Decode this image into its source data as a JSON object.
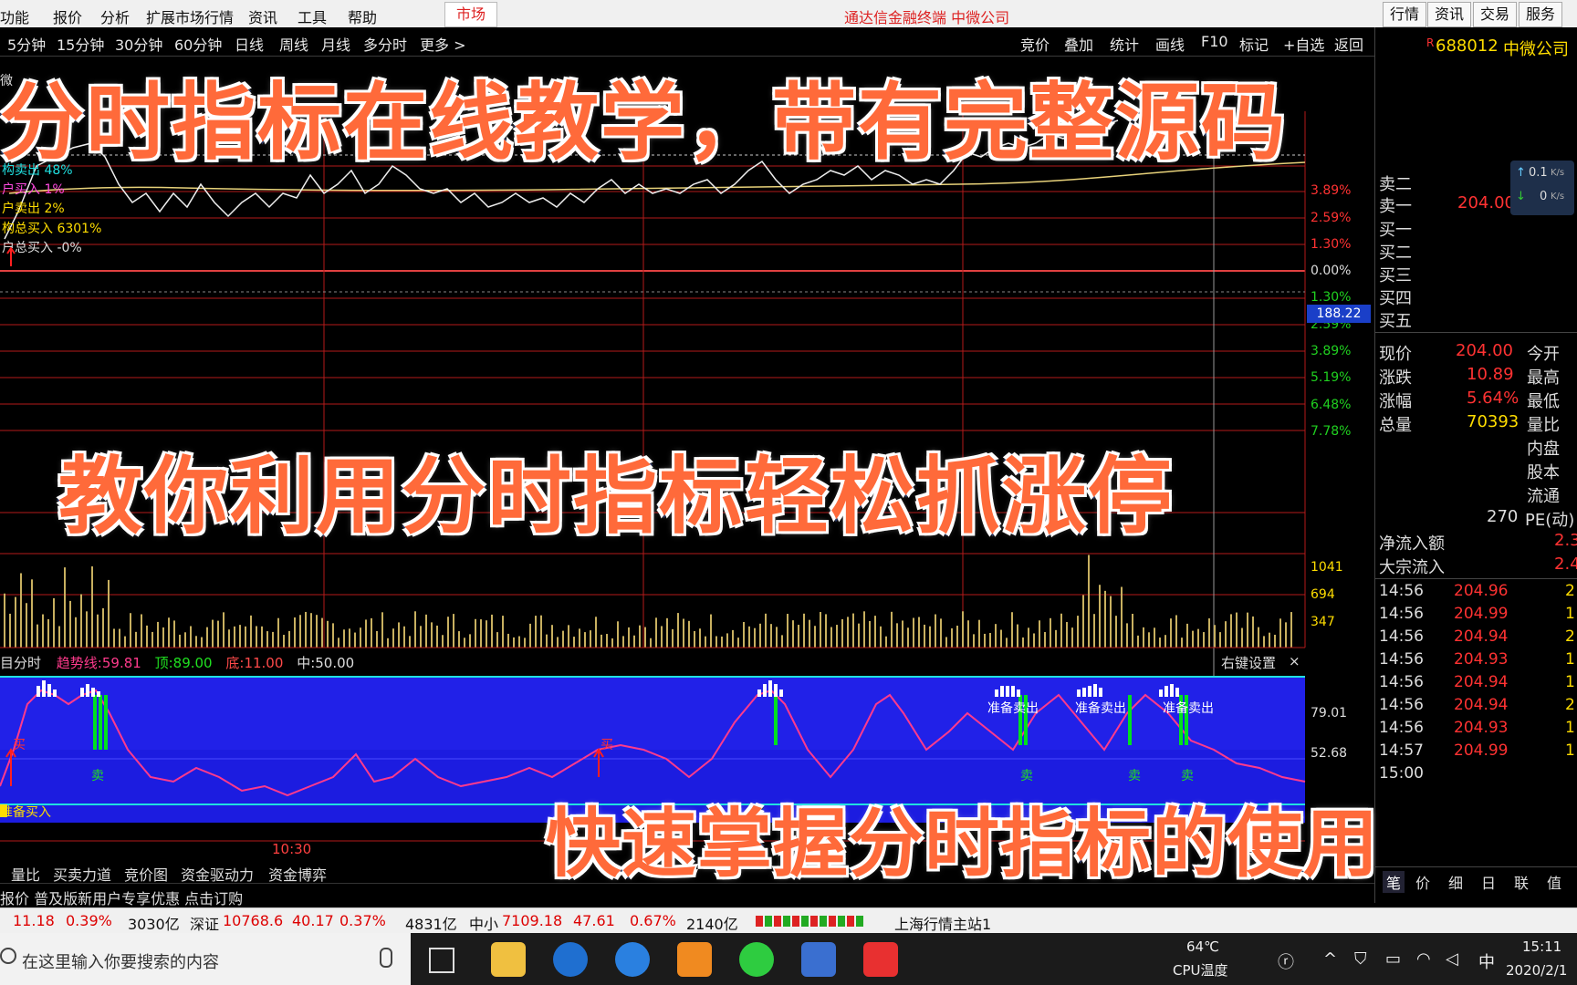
{
  "menubar": {
    "items": [
      "功能",
      "报价",
      "分析",
      "扩展市场行情",
      "资讯",
      "工具",
      "帮助"
    ],
    "market_tab": "市场",
    "app_title": "通达信金融终端  中微公司",
    "right_buttons": [
      "行情",
      "资讯",
      "交易",
      "服务"
    ]
  },
  "toolbar": {
    "periods": [
      "5分钟",
      "15分钟",
      "30分钟",
      "60分钟",
      "日线",
      "周线",
      "月线",
      "多分时",
      "更多 >"
    ],
    "tools": [
      "竞价",
      "叠加",
      "统计",
      "画线",
      "F10",
      "标记",
      "+自选",
      "返回"
    ]
  },
  "chart": {
    "left_labels": [
      "构卖出 48%",
      "户买入 1%",
      "户卖出 2%",
      "构总买入 6301%",
      "户总买入 -0%"
    ],
    "pct_axis": [
      "3.89%",
      "2.59%",
      "1.30%",
      "0.00%",
      "1.30%",
      "2.59%",
      "3.89%",
      "5.19%",
      "6.48%",
      "7.78%"
    ],
    "price_tag": "188.22",
    "volume_axis": [
      "1041",
      "694",
      "347"
    ],
    "time_label": "10:30",
    "indicator_header": {
      "name": "目分时",
      "trend_label": "趋势线:",
      "trend_value": "59.81",
      "top_label": "顶:",
      "top_value": "89.00",
      "bottom_label": "底:",
      "bottom_value": "11.00",
      "mid_label": "中:",
      "mid_value": "50.00"
    },
    "indicator_settings": "右键设置",
    "indicator_axis": [
      "79.01",
      "52.68"
    ],
    "signal_buy": "买",
    "signal_sell": "卖",
    "signal_prepare_sell": "准备卖出",
    "signal_prepare_buy": "准备买入"
  },
  "right_panel": {
    "stock_code": "688012",
    "stock_name": "中微公司",
    "flag": "R",
    "sell_rows": [
      "卖二",
      "卖一"
    ],
    "sell1_price": "204.00",
    "speed1": "0.1",
    "speed2": "0",
    "speed_unit": "K/s",
    "buy_rows": [
      "买一",
      "买二",
      "买三",
      "买四",
      "买五"
    ],
    "quote_rows": [
      {
        "label": "现价",
        "value": "204.00",
        "right": "今开"
      },
      {
        "label": "涨跌",
        "value": "10.89",
        "right": "最高"
      },
      {
        "label": "涨幅",
        "value": "5.64%",
        "right": "最低"
      },
      {
        "label": "总量",
        "value": "70393",
        "right": "量比"
      }
    ],
    "extra_rows": [
      "内盘",
      "股本",
      "流通",
      "PE(动)"
    ],
    "pe_value": "270",
    "net_inflow_label": "净流入额",
    "net_inflow_value": "2.3",
    "block_inflow_label": "大宗流入",
    "block_inflow_value": "2.4",
    "ticks": [
      {
        "time": "14:56",
        "price": "204.96",
        "vol": "2"
      },
      {
        "time": "14:56",
        "price": "204.99",
        "vol": "1"
      },
      {
        "time": "14:56",
        "price": "204.94",
        "vol": "2"
      },
      {
        "time": "14:56",
        "price": "204.93",
        "vol": "1"
      },
      {
        "time": "14:56",
        "price": "204.94",
        "vol": "1"
      },
      {
        "time": "14:56",
        "price": "204.94",
        "vol": "2"
      },
      {
        "time": "14:56",
        "price": "204.93",
        "vol": "1"
      },
      {
        "time": "14:57",
        "price": "204.99",
        "vol": "1"
      },
      {
        "time": "15:00",
        "price": "",
        "vol": ""
      }
    ],
    "bottom_tabs": [
      "笔",
      "价",
      "细",
      "日",
      "联",
      "值"
    ]
  },
  "bottom_tabs": [
    "量比",
    "买卖力道",
    "竞价图",
    "资金驱动力",
    "资金博弈"
  ],
  "promo": "报价  普及版新用户专享优惠  点击订购",
  "status": {
    "sh_change": "11.18",
    "sh_pct": "0.39%",
    "sh_amount": "3030亿",
    "sz_label": "深证",
    "sz_index": "10768.6",
    "sz_change": "40.17",
    "sz_pct": "0.37%",
    "sz_amount": "4831亿",
    "zx_label": "中小",
    "zx_index": "7109.18",
    "zx_change": "47.61",
    "zx_pct": "0.67%",
    "zx_amount": "2140亿",
    "server": "上海行情主站1"
  },
  "taskbar": {
    "search_placeholder": "在这里输入你要搜索的内容",
    "temp": "64℃",
    "temp_label": "CPU温度",
    "ime": "中",
    "time": "15:11",
    "date": "2020/2/1"
  },
  "captions": {
    "top": "分时指标在线教学，带有完整源码",
    "middle": "教你利用分时指标轻松抓涨停",
    "bottom": "快速掌握分时指标的使用"
  }
}
